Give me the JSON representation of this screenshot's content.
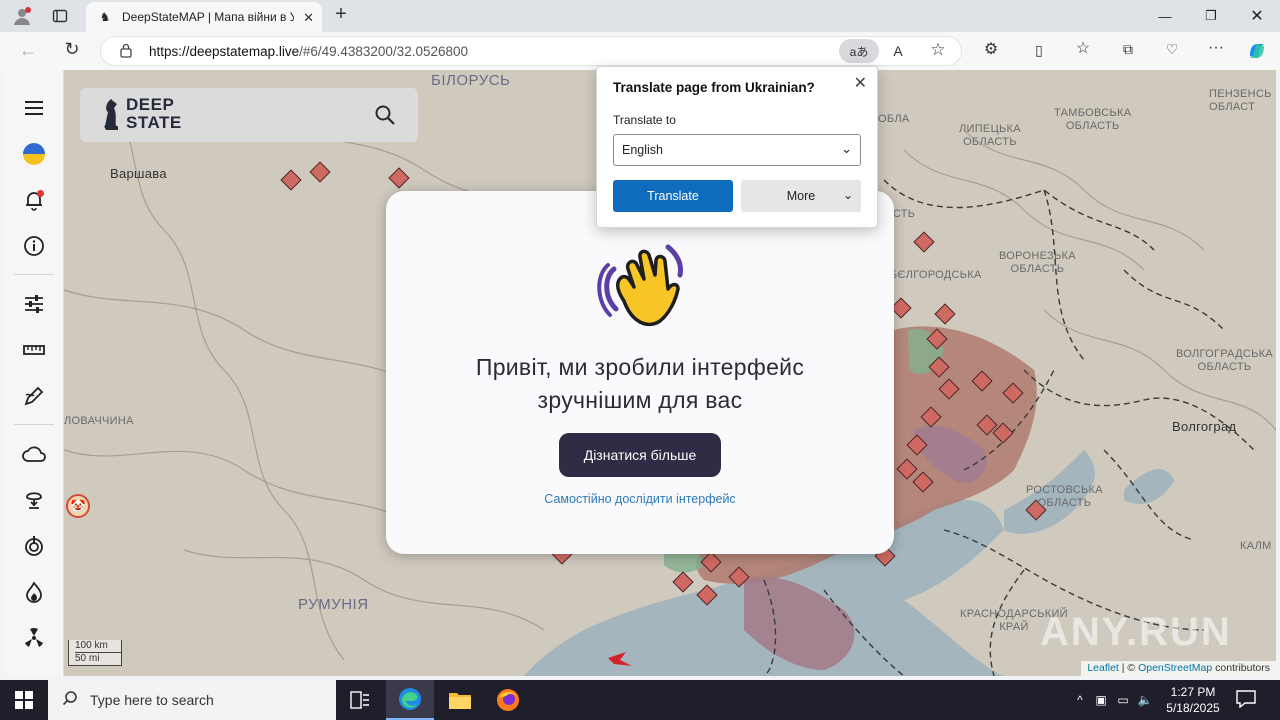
{
  "browser": {
    "tab_title": "DeepStateMAP | Мапа війни в Ук",
    "url_host": "https://deepstatemap.live",
    "url_path": "/#6/49.4383200/32.0526800",
    "translate_chip": "aあ"
  },
  "sidebar": {
    "icons": [
      "menu-icon",
      "ukraine-flag-icon",
      "notifications-icon",
      "info-icon",
      "filters-icon",
      "ruler-icon",
      "draw-icon",
      "weather-icon",
      "explosion-icon",
      "target-icon",
      "fire-icon",
      "radiation-icon"
    ]
  },
  "logo": {
    "line1": "DEEP",
    "line2": "STATE"
  },
  "map_labels": {
    "belarus": "БІЛОРУСЬ",
    "warsaw": "Варшава",
    "romania": "РУМУНІЯ",
    "slovakia": "ЛОВАЧЧИНА",
    "tambov": "ТАМБОВСЬКА\nОБЛАСТЬ",
    "lipetsk": "ЛИПЕЦЬКА\nОБЛАСТЬ",
    "penza": "ПЕНЗЕНСЬ\nОБЛАСТ",
    "voronezh": "ВОРОНЕЗЬКА\nОБЛАСТЬ",
    "volgograd_obl": "ВОЛГОГРАДСЬКА\nОБЛАСТЬ",
    "volgograd": "Волгоград",
    "rostov": "РОСТОВСЬКА\nОБЛАСТЬ",
    "krasnodar": "КРАСНОДАРСЬКИЙ\nКРАЙ",
    "kalm": "КАЛМ",
    "belgorod": "БЄЛГОРОДСЬКА",
    "obl_fragment": "ОБЛА",
    "obl_fragment2": "ЛАСТЬ"
  },
  "modal": {
    "title_line1": "Привіт, ми зробили інтерфейс",
    "title_line2": "зручнішим для вас",
    "button": "Дізнатися більше",
    "link": "Самостійно дослідити інтерфейс"
  },
  "translate_popup": {
    "title": "Translate page from Ukrainian?",
    "subtitle": "Translate to",
    "language": "English",
    "translate_button": "Translate",
    "more_button": "More"
  },
  "scale": {
    "km": "100 km",
    "mi": "50 mi"
  },
  "attribution": {
    "leaflet": "Leaflet",
    "sep": " | © ",
    "osm": "OpenStreetMap",
    "rest": " contributors"
  },
  "taskbar": {
    "search_placeholder": "Type here to search",
    "time": "1:27 PM",
    "date": "5/18/2025"
  },
  "watermark": "ANY.RUN",
  "colors": {
    "occupied": "#b07a6e",
    "modal_button": "#2f2d46",
    "link": "#2b7bb9",
    "translate_primary": "#0f6cbd"
  }
}
